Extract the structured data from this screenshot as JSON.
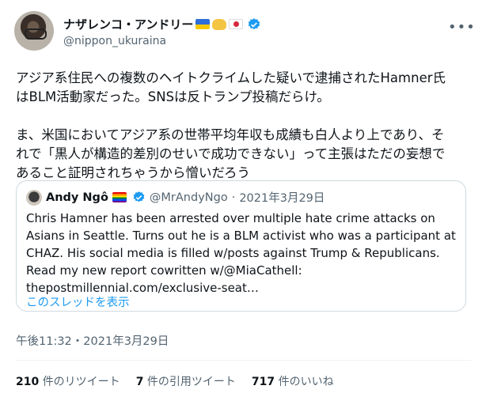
{
  "author": {
    "display_name": "ナザレンコ・アンドリー",
    "handle": "@nippon_ukuraina"
  },
  "tweet": {
    "text": "アジア系住民への複数のヘイトクライムした疑いで逮捕されたHamner氏\nはBLM活動家だった。SNSは反トランプ投稿だらけ。\n\nま、米国においてアジア系の世帯平均年収も成績も白人より上であり、そ\nれで「黒人が構造的差別のせいで成功できない」って主張はただの妄想で\nあること証明されちゃうから憎いだろう",
    "timestamp": "午後11:32・2021年3月29日"
  },
  "quote": {
    "name": "Andy Ngô",
    "handle": "@MrAndyNgo",
    "dot": "·",
    "date": "2021年3月29日",
    "text": "Chris Hamner has been arrested over multiple hate crime attacks on\nAsians in Seattle. Turns out he is a BLM activist who was a participant at\nCHAZ. His social media is filled w/posts against Trump & Republicans.\nRead my new report cowritten w/@MiaCathell:\nthepostmillennial.com/exclusive-seat…",
    "thread_link": "このスレッドを表示"
  },
  "stats": {
    "retweets_count": "210",
    "retweets_label": "件のリツイート",
    "quotes_count": "7",
    "quotes_label": "件の引用ツイート",
    "likes_count": "717",
    "likes_label": "件のいいね"
  },
  "colors": {
    "accent": "#1d9bf0",
    "muted": "#536471",
    "border": "#cfd9de"
  },
  "icons": [
    "ukraine-flag-icon",
    "handshake-icon",
    "japan-flag-icon",
    "verified-icon",
    "more-icon",
    "rainbow-flag-icon"
  ]
}
